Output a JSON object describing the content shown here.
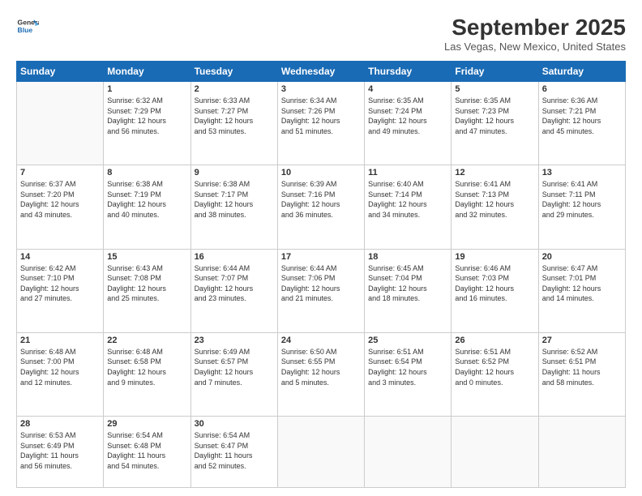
{
  "header": {
    "logo_line1": "General",
    "logo_line2": "Blue",
    "title": "September 2025",
    "subtitle": "Las Vegas, New Mexico, United States"
  },
  "weekdays": [
    "Sunday",
    "Monday",
    "Tuesday",
    "Wednesday",
    "Thursday",
    "Friday",
    "Saturday"
  ],
  "weeks": [
    [
      {
        "day": "",
        "text": ""
      },
      {
        "day": "1",
        "text": "Sunrise: 6:32 AM\nSunset: 7:29 PM\nDaylight: 12 hours\nand 56 minutes."
      },
      {
        "day": "2",
        "text": "Sunrise: 6:33 AM\nSunset: 7:27 PM\nDaylight: 12 hours\nand 53 minutes."
      },
      {
        "day": "3",
        "text": "Sunrise: 6:34 AM\nSunset: 7:26 PM\nDaylight: 12 hours\nand 51 minutes."
      },
      {
        "day": "4",
        "text": "Sunrise: 6:35 AM\nSunset: 7:24 PM\nDaylight: 12 hours\nand 49 minutes."
      },
      {
        "day": "5",
        "text": "Sunrise: 6:35 AM\nSunset: 7:23 PM\nDaylight: 12 hours\nand 47 minutes."
      },
      {
        "day": "6",
        "text": "Sunrise: 6:36 AM\nSunset: 7:21 PM\nDaylight: 12 hours\nand 45 minutes."
      }
    ],
    [
      {
        "day": "7",
        "text": "Sunrise: 6:37 AM\nSunset: 7:20 PM\nDaylight: 12 hours\nand 43 minutes."
      },
      {
        "day": "8",
        "text": "Sunrise: 6:38 AM\nSunset: 7:19 PM\nDaylight: 12 hours\nand 40 minutes."
      },
      {
        "day": "9",
        "text": "Sunrise: 6:38 AM\nSunset: 7:17 PM\nDaylight: 12 hours\nand 38 minutes."
      },
      {
        "day": "10",
        "text": "Sunrise: 6:39 AM\nSunset: 7:16 PM\nDaylight: 12 hours\nand 36 minutes."
      },
      {
        "day": "11",
        "text": "Sunrise: 6:40 AM\nSunset: 7:14 PM\nDaylight: 12 hours\nand 34 minutes."
      },
      {
        "day": "12",
        "text": "Sunrise: 6:41 AM\nSunset: 7:13 PM\nDaylight: 12 hours\nand 32 minutes."
      },
      {
        "day": "13",
        "text": "Sunrise: 6:41 AM\nSunset: 7:11 PM\nDaylight: 12 hours\nand 29 minutes."
      }
    ],
    [
      {
        "day": "14",
        "text": "Sunrise: 6:42 AM\nSunset: 7:10 PM\nDaylight: 12 hours\nand 27 minutes."
      },
      {
        "day": "15",
        "text": "Sunrise: 6:43 AM\nSunset: 7:08 PM\nDaylight: 12 hours\nand 25 minutes."
      },
      {
        "day": "16",
        "text": "Sunrise: 6:44 AM\nSunset: 7:07 PM\nDaylight: 12 hours\nand 23 minutes."
      },
      {
        "day": "17",
        "text": "Sunrise: 6:44 AM\nSunset: 7:06 PM\nDaylight: 12 hours\nand 21 minutes."
      },
      {
        "day": "18",
        "text": "Sunrise: 6:45 AM\nSunset: 7:04 PM\nDaylight: 12 hours\nand 18 minutes."
      },
      {
        "day": "19",
        "text": "Sunrise: 6:46 AM\nSunset: 7:03 PM\nDaylight: 12 hours\nand 16 minutes."
      },
      {
        "day": "20",
        "text": "Sunrise: 6:47 AM\nSunset: 7:01 PM\nDaylight: 12 hours\nand 14 minutes."
      }
    ],
    [
      {
        "day": "21",
        "text": "Sunrise: 6:48 AM\nSunset: 7:00 PM\nDaylight: 12 hours\nand 12 minutes."
      },
      {
        "day": "22",
        "text": "Sunrise: 6:48 AM\nSunset: 6:58 PM\nDaylight: 12 hours\nand 9 minutes."
      },
      {
        "day": "23",
        "text": "Sunrise: 6:49 AM\nSunset: 6:57 PM\nDaylight: 12 hours\nand 7 minutes."
      },
      {
        "day": "24",
        "text": "Sunrise: 6:50 AM\nSunset: 6:55 PM\nDaylight: 12 hours\nand 5 minutes."
      },
      {
        "day": "25",
        "text": "Sunrise: 6:51 AM\nSunset: 6:54 PM\nDaylight: 12 hours\nand 3 minutes."
      },
      {
        "day": "26",
        "text": "Sunrise: 6:51 AM\nSunset: 6:52 PM\nDaylight: 12 hours\nand 0 minutes."
      },
      {
        "day": "27",
        "text": "Sunrise: 6:52 AM\nSunset: 6:51 PM\nDaylight: 11 hours\nand 58 minutes."
      }
    ],
    [
      {
        "day": "28",
        "text": "Sunrise: 6:53 AM\nSunset: 6:49 PM\nDaylight: 11 hours\nand 56 minutes."
      },
      {
        "day": "29",
        "text": "Sunrise: 6:54 AM\nSunset: 6:48 PM\nDaylight: 11 hours\nand 54 minutes."
      },
      {
        "day": "30",
        "text": "Sunrise: 6:54 AM\nSunset: 6:47 PM\nDaylight: 11 hours\nand 52 minutes."
      },
      {
        "day": "",
        "text": ""
      },
      {
        "day": "",
        "text": ""
      },
      {
        "day": "",
        "text": ""
      },
      {
        "day": "",
        "text": ""
      }
    ]
  ]
}
